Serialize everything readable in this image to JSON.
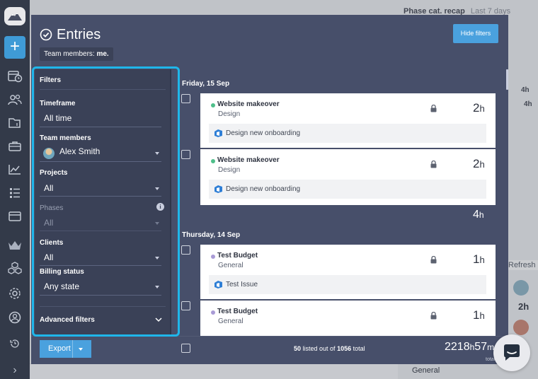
{
  "background": {
    "recap_title": "Phase cat. recap",
    "recap_range": "Last 7 days",
    "side_values": [
      "4h",
      "4h"
    ],
    "refresh_label": "Refresh",
    "side_total": "2h",
    "side_project": "General"
  },
  "modal": {
    "title": "Entries",
    "members_prefix": "Team members:",
    "members_value": "me.",
    "hide_filters_label": "Hide filters"
  },
  "filters": {
    "heading": "Filters",
    "timeframe_label": "Timeframe",
    "timeframe_value": "All time",
    "team_label": "Team members",
    "team_value": "Alex Smith",
    "projects_label": "Projects",
    "projects_value": "All",
    "phases_label": "Phases",
    "phases_value": "All",
    "clients_label": "Clients",
    "clients_value": "All",
    "billing_label": "Billing status",
    "billing_value": "Any state",
    "advanced_label": "Advanced filters"
  },
  "days": [
    {
      "label": "Friday, 15 Sep",
      "total": "4",
      "entries": [
        {
          "project": "Website makeover",
          "task": "Design",
          "hours": "2",
          "issue": "Design new onboarding",
          "dot_color": "#4fbf8a"
        },
        {
          "project": "Website makeover",
          "task": "Design",
          "hours": "2",
          "issue": "Design new onboarding",
          "dot_color": "#4fbf8a"
        }
      ]
    },
    {
      "label": "Thursday, 14 Sep",
      "entries": [
        {
          "project": "Test Budget",
          "task": "General",
          "hours": "1",
          "issue": "Test Issue",
          "dot_color": "#a99bd6"
        },
        {
          "project": "Test Budget",
          "task": "General",
          "hours": "1",
          "dot_color": "#a99bd6"
        }
      ]
    }
  ],
  "units": {
    "hour": "h",
    "minute": "m"
  },
  "footer": {
    "export_label": "Export",
    "listed_count": "50",
    "listed_text": "listed out of",
    "total_count": "1056",
    "total_word": "total",
    "grand_hours": "2218",
    "grand_minutes": "57",
    "grand_label": "total"
  },
  "colors": {
    "accent": "#4aa1de",
    "modal_bg": "#474f6a",
    "filters_bg": "#3a4157",
    "highlight": "#1fb6ea"
  }
}
